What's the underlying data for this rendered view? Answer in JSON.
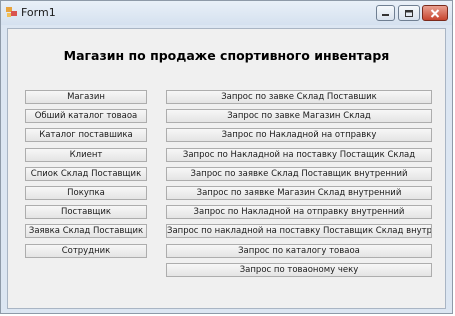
{
  "window": {
    "title": "Form1"
  },
  "heading": "Магазин по продаже спортивного инвентаря",
  "left_buttons": [
    "Магазин",
    "Обший каталог товаоа",
    "Каталог поставшика",
    "Клиент",
    "Спиок Склад  Поставщик",
    "Покупка",
    "Поставщик",
    "Заявка Склад  Поставщик",
    "Сотрудник"
  ],
  "right_buttons": [
    "Запрос по завке Склад  Поставшик",
    "Запрос по завке Магазин  Склад",
    "Запрос по Накладной на отправку",
    "Запрос по Накладной на поставку Постащик  Склад",
    "Запрос по заявке Склад  Поставщик внутренний",
    "Запрос по заявке Магазин  Склад внутренний",
    "Запрос по Накладной на отправку внутренний",
    "Запрос по накладной на поставку Поставщик  Склад внутренний",
    "Запрос по каталогу товаоа",
    "Запрос по товаоному чеку"
  ],
  "icons": {
    "app": "form-app-icon",
    "minimize": "minimize-icon",
    "maximize": "maximize-icon",
    "close": "close-icon"
  }
}
